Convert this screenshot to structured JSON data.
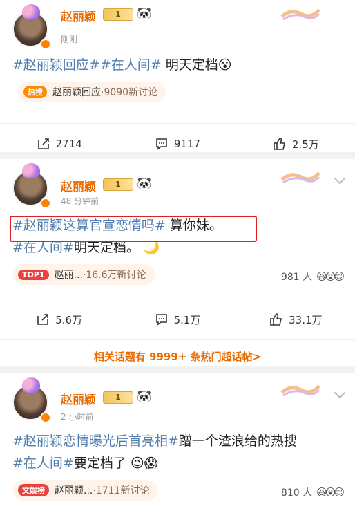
{
  "posts": [
    {
      "name": "赵丽颖",
      "level": "1",
      "time": "刚刚",
      "tags": [
        "#赵丽颖回应#",
        "#在人间#"
      ],
      "text": " 明天定档",
      "emoji": "😮",
      "hot_icon": "热搜",
      "hot_title": "赵丽颖回应",
      "hot_meta": "·9090新讨论",
      "forward": "2714",
      "comment": "9117",
      "like": "2.5万"
    },
    {
      "name": "赵丽颖",
      "level": "1",
      "time": "48 分钟前",
      "tag1": "#赵丽颖这算官宣恋情吗#",
      "text1": " 算你妹。",
      "tag2": "#在人间#",
      "text2": "明天定档。",
      "emoji": "🌙",
      "hot_icon": "TOP1",
      "hot_title": "赵丽...",
      "hot_meta": "·16.6万新讨论",
      "people": "981 人",
      "forward": "5.6万",
      "comment": "5.1万",
      "like": "33.1万",
      "more": "相关话题有 9999+ 条热门超话帖>"
    },
    {
      "name": "赵丽颖",
      "level": "1",
      "time": "2 小时前",
      "tag1": "#赵丽颖恋情曝光后首亮相#",
      "text1": "蹭一个渣浪给的热搜",
      "tag2": "#在人间#",
      "text2": "要定档了",
      "emoji": "😉😱",
      "hot_icon": "文娱榜",
      "hot_title": "赵丽颖...",
      "hot_meta": "·1711新讨论",
      "people": "810 人"
    }
  ],
  "icons": {
    "panda": "panda-emoji",
    "crown": "crown-icon",
    "forward": "forward-icon",
    "comment": "comment-icon",
    "like": "like-icon"
  },
  "colors": {
    "accent": "#e96b00",
    "tag": "#507daf",
    "highlight_box": "#e02020"
  }
}
